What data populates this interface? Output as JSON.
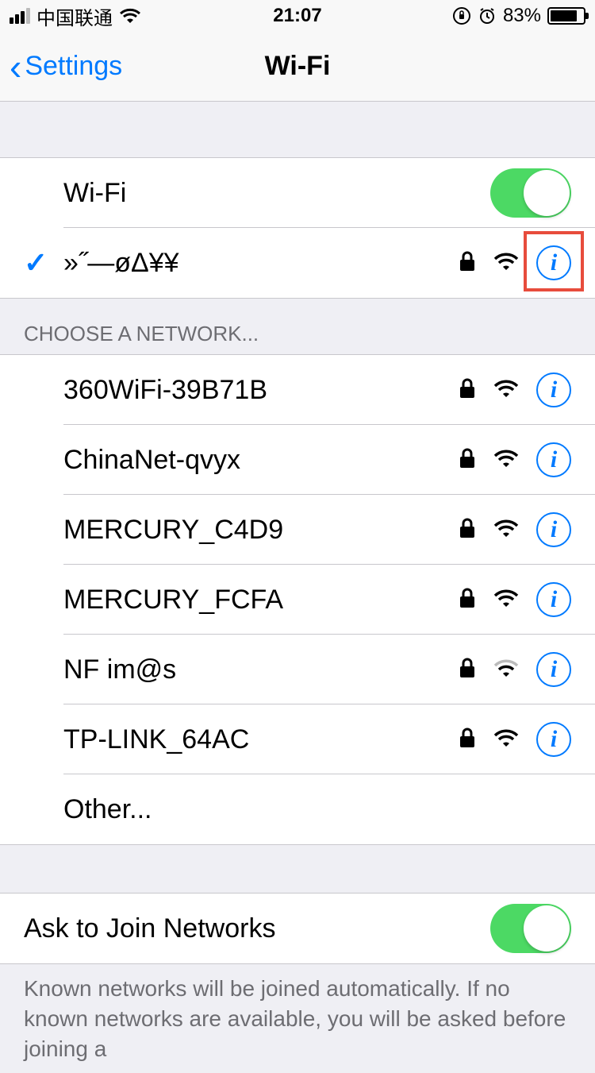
{
  "status": {
    "carrier": "中国联通",
    "time": "21:07",
    "battery_pct": "83%"
  },
  "nav": {
    "back_label": "Settings",
    "title": "Wi-Fi"
  },
  "wifi_toggle": {
    "label": "Wi-Fi",
    "on": true
  },
  "connected": {
    "ssid": "»˝—øΔ¥¥",
    "locked": true
  },
  "choose_header": "CHOOSE A NETWORK...",
  "networks": [
    {
      "ssid": "360WiFi-39B71B",
      "locked": true,
      "signal": "strong"
    },
    {
      "ssid": "ChinaNet-qvyx",
      "locked": true,
      "signal": "strong"
    },
    {
      "ssid": "MERCURY_C4D9",
      "locked": true,
      "signal": "strong"
    },
    {
      "ssid": "MERCURY_FCFA",
      "locked": true,
      "signal": "strong"
    },
    {
      "ssid": "NF im@s",
      "locked": true,
      "signal": "weak"
    },
    {
      "ssid": "TP-LINK_64AC",
      "locked": true,
      "signal": "strong"
    }
  ],
  "other_label": "Other...",
  "ask_join": {
    "label": "Ask to Join Networks",
    "on": true
  },
  "footer": "Known networks will be joined automatically. If no known networks are available, you will be asked before joining a"
}
